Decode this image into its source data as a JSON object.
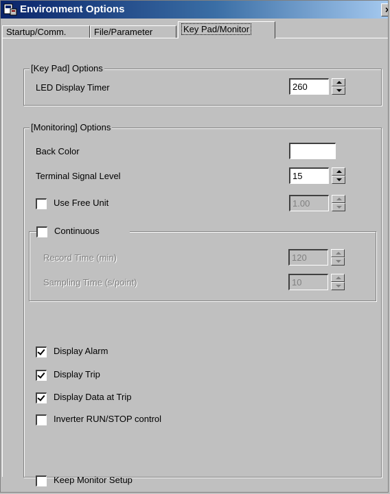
{
  "window": {
    "title": "Environment Options",
    "close_label": "×"
  },
  "tabs": [
    {
      "label": "Startup/Comm."
    },
    {
      "label": "File/Parameter"
    },
    {
      "label": "Key Pad/Monitor"
    }
  ],
  "keypad": {
    "group_label": "[Key Pad] Options",
    "led_timer_label": "LED Display Timer",
    "led_timer_value": "260"
  },
  "monitoring": {
    "group_label": "[Monitoring] Options",
    "back_color_label": "Back Color",
    "back_color": "#ffffff",
    "terminal_signal_label": "Terminal Signal Level",
    "terminal_signal_value": "15",
    "use_free_unit_label": "Use Free Unit",
    "use_free_unit_value": "1.00",
    "continuous": {
      "label": "Continuous",
      "record_time_label": "Record Time (min)",
      "record_time_value": "120",
      "sampling_time_label": "Sampling Time (s/point)",
      "sampling_time_value": "10"
    },
    "display_alarm_label": "Display Alarm",
    "display_trip_label": "Display Trip",
    "display_data_at_trip_label": "Display Data at Trip",
    "inverter_control_label": "Inverter RUN/STOP control",
    "keep_monitor_label": "Keep Monitor Setup"
  },
  "icons": {
    "app": "app-window-icon",
    "close": "close-icon"
  }
}
